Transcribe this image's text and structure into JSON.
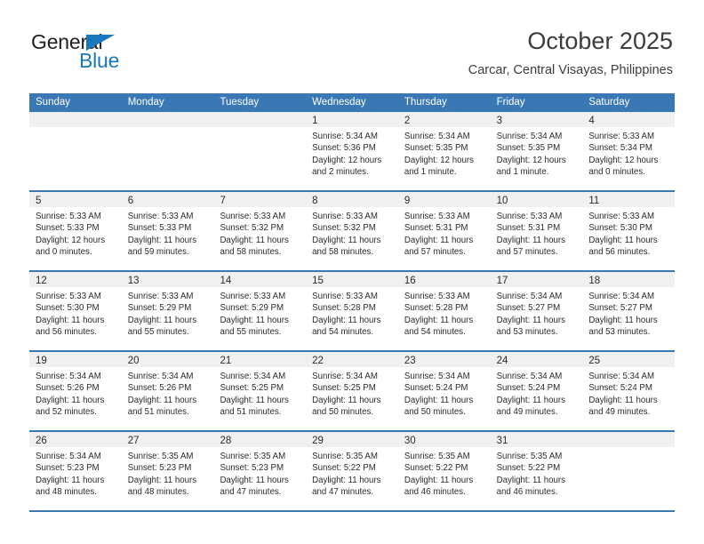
{
  "brand": {
    "name_top": "General",
    "name_bottom": "Blue",
    "triangle_color": "#1878be"
  },
  "header": {
    "title": "October 2025",
    "subtitle": "Carcar, Central Visayas, Philippines"
  },
  "theme": {
    "header_blue": "#3a78b5",
    "daynum_strip": "#f0f0f0",
    "text": "#2b2b2b"
  },
  "calendar": {
    "weekdays": [
      "Sunday",
      "Monday",
      "Tuesday",
      "Wednesday",
      "Thursday",
      "Friday",
      "Saturday"
    ],
    "weeks": [
      [
        {
          "day": "",
          "sunrise": "",
          "sunset": "",
          "daylight1": "",
          "daylight2": ""
        },
        {
          "day": "",
          "sunrise": "",
          "sunset": "",
          "daylight1": "",
          "daylight2": ""
        },
        {
          "day": "",
          "sunrise": "",
          "sunset": "",
          "daylight1": "",
          "daylight2": ""
        },
        {
          "day": "1",
          "sunrise": "Sunrise: 5:34 AM",
          "sunset": "Sunset: 5:36 PM",
          "daylight1": "Daylight: 12 hours",
          "daylight2": "and 2 minutes."
        },
        {
          "day": "2",
          "sunrise": "Sunrise: 5:34 AM",
          "sunset": "Sunset: 5:35 PM",
          "daylight1": "Daylight: 12 hours",
          "daylight2": "and 1 minute."
        },
        {
          "day": "3",
          "sunrise": "Sunrise: 5:34 AM",
          "sunset": "Sunset: 5:35 PM",
          "daylight1": "Daylight: 12 hours",
          "daylight2": "and 1 minute."
        },
        {
          "day": "4",
          "sunrise": "Sunrise: 5:33 AM",
          "sunset": "Sunset: 5:34 PM",
          "daylight1": "Daylight: 12 hours",
          "daylight2": "and 0 minutes."
        }
      ],
      [
        {
          "day": "5",
          "sunrise": "Sunrise: 5:33 AM",
          "sunset": "Sunset: 5:33 PM",
          "daylight1": "Daylight: 12 hours",
          "daylight2": "and 0 minutes."
        },
        {
          "day": "6",
          "sunrise": "Sunrise: 5:33 AM",
          "sunset": "Sunset: 5:33 PM",
          "daylight1": "Daylight: 11 hours",
          "daylight2": "and 59 minutes."
        },
        {
          "day": "7",
          "sunrise": "Sunrise: 5:33 AM",
          "sunset": "Sunset: 5:32 PM",
          "daylight1": "Daylight: 11 hours",
          "daylight2": "and 58 minutes."
        },
        {
          "day": "8",
          "sunrise": "Sunrise: 5:33 AM",
          "sunset": "Sunset: 5:32 PM",
          "daylight1": "Daylight: 11 hours",
          "daylight2": "and 58 minutes."
        },
        {
          "day": "9",
          "sunrise": "Sunrise: 5:33 AM",
          "sunset": "Sunset: 5:31 PM",
          "daylight1": "Daylight: 11 hours",
          "daylight2": "and 57 minutes."
        },
        {
          "day": "10",
          "sunrise": "Sunrise: 5:33 AM",
          "sunset": "Sunset: 5:31 PM",
          "daylight1": "Daylight: 11 hours",
          "daylight2": "and 57 minutes."
        },
        {
          "day": "11",
          "sunrise": "Sunrise: 5:33 AM",
          "sunset": "Sunset: 5:30 PM",
          "daylight1": "Daylight: 11 hours",
          "daylight2": "and 56 minutes."
        }
      ],
      [
        {
          "day": "12",
          "sunrise": "Sunrise: 5:33 AM",
          "sunset": "Sunset: 5:30 PM",
          "daylight1": "Daylight: 11 hours",
          "daylight2": "and 56 minutes."
        },
        {
          "day": "13",
          "sunrise": "Sunrise: 5:33 AM",
          "sunset": "Sunset: 5:29 PM",
          "daylight1": "Daylight: 11 hours",
          "daylight2": "and 55 minutes."
        },
        {
          "day": "14",
          "sunrise": "Sunrise: 5:33 AM",
          "sunset": "Sunset: 5:29 PM",
          "daylight1": "Daylight: 11 hours",
          "daylight2": "and 55 minutes."
        },
        {
          "day": "15",
          "sunrise": "Sunrise: 5:33 AM",
          "sunset": "Sunset: 5:28 PM",
          "daylight1": "Daylight: 11 hours",
          "daylight2": "and 54 minutes."
        },
        {
          "day": "16",
          "sunrise": "Sunrise: 5:33 AM",
          "sunset": "Sunset: 5:28 PM",
          "daylight1": "Daylight: 11 hours",
          "daylight2": "and 54 minutes."
        },
        {
          "day": "17",
          "sunrise": "Sunrise: 5:34 AM",
          "sunset": "Sunset: 5:27 PM",
          "daylight1": "Daylight: 11 hours",
          "daylight2": "and 53 minutes."
        },
        {
          "day": "18",
          "sunrise": "Sunrise: 5:34 AM",
          "sunset": "Sunset: 5:27 PM",
          "daylight1": "Daylight: 11 hours",
          "daylight2": "and 53 minutes."
        }
      ],
      [
        {
          "day": "19",
          "sunrise": "Sunrise: 5:34 AM",
          "sunset": "Sunset: 5:26 PM",
          "daylight1": "Daylight: 11 hours",
          "daylight2": "and 52 minutes."
        },
        {
          "day": "20",
          "sunrise": "Sunrise: 5:34 AM",
          "sunset": "Sunset: 5:26 PM",
          "daylight1": "Daylight: 11 hours",
          "daylight2": "and 51 minutes."
        },
        {
          "day": "21",
          "sunrise": "Sunrise: 5:34 AM",
          "sunset": "Sunset: 5:25 PM",
          "daylight1": "Daylight: 11 hours",
          "daylight2": "and 51 minutes."
        },
        {
          "day": "22",
          "sunrise": "Sunrise: 5:34 AM",
          "sunset": "Sunset: 5:25 PM",
          "daylight1": "Daylight: 11 hours",
          "daylight2": "and 50 minutes."
        },
        {
          "day": "23",
          "sunrise": "Sunrise: 5:34 AM",
          "sunset": "Sunset: 5:24 PM",
          "daylight1": "Daylight: 11 hours",
          "daylight2": "and 50 minutes."
        },
        {
          "day": "24",
          "sunrise": "Sunrise: 5:34 AM",
          "sunset": "Sunset: 5:24 PM",
          "daylight1": "Daylight: 11 hours",
          "daylight2": "and 49 minutes."
        },
        {
          "day": "25",
          "sunrise": "Sunrise: 5:34 AM",
          "sunset": "Sunset: 5:24 PM",
          "daylight1": "Daylight: 11 hours",
          "daylight2": "and 49 minutes."
        }
      ],
      [
        {
          "day": "26",
          "sunrise": "Sunrise: 5:34 AM",
          "sunset": "Sunset: 5:23 PM",
          "daylight1": "Daylight: 11 hours",
          "daylight2": "and 48 minutes."
        },
        {
          "day": "27",
          "sunrise": "Sunrise: 5:35 AM",
          "sunset": "Sunset: 5:23 PM",
          "daylight1": "Daylight: 11 hours",
          "daylight2": "and 48 minutes."
        },
        {
          "day": "28",
          "sunrise": "Sunrise: 5:35 AM",
          "sunset": "Sunset: 5:23 PM",
          "daylight1": "Daylight: 11 hours",
          "daylight2": "and 47 minutes."
        },
        {
          "day": "29",
          "sunrise": "Sunrise: 5:35 AM",
          "sunset": "Sunset: 5:22 PM",
          "daylight1": "Daylight: 11 hours",
          "daylight2": "and 47 minutes."
        },
        {
          "day": "30",
          "sunrise": "Sunrise: 5:35 AM",
          "sunset": "Sunset: 5:22 PM",
          "daylight1": "Daylight: 11 hours",
          "daylight2": "and 46 minutes."
        },
        {
          "day": "31",
          "sunrise": "Sunrise: 5:35 AM",
          "sunset": "Sunset: 5:22 PM",
          "daylight1": "Daylight: 11 hours",
          "daylight2": "and 46 minutes."
        },
        {
          "day": "",
          "sunrise": "",
          "sunset": "",
          "daylight1": "",
          "daylight2": ""
        }
      ]
    ]
  }
}
